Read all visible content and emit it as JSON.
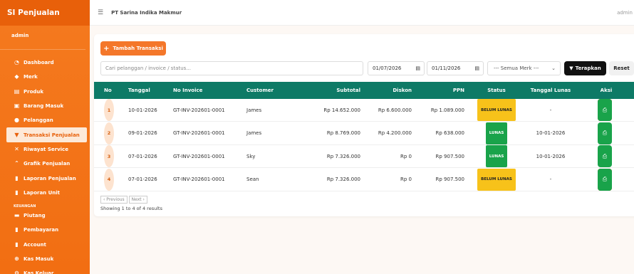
{
  "app": {
    "brand": "SI Penjualan",
    "user": "admin",
    "company": "PT Sarina Indika Makmur",
    "top_user": "admin"
  },
  "sidebar": {
    "items": [
      {
        "label": "Dashboard",
        "icon": "dashboard-icon"
      },
      {
        "label": "Merk",
        "icon": "tag-icon"
      },
      {
        "label": "Produk",
        "icon": "box-icon"
      },
      {
        "label": "Barang Masuk",
        "icon": "truck-icon"
      },
      {
        "label": "Pelanggan",
        "icon": "users-icon"
      },
      {
        "label": "Transaksi Penjualan",
        "icon": "cart-icon",
        "active": true
      },
      {
        "label": "Riwayat Service",
        "icon": "tools-icon"
      },
      {
        "label": "Grafik Penjualan",
        "icon": "chart-icon"
      },
      {
        "label": "Laporan Penjualan",
        "icon": "file-icon"
      },
      {
        "label": "Laporan Unit",
        "icon": "file-icon"
      }
    ],
    "section_keuangan": "KEUANGAN",
    "items2": [
      {
        "label": "Piutang",
        "icon": "card-icon"
      },
      {
        "label": "Pembayaran",
        "icon": "file-icon"
      },
      {
        "label": "Account",
        "icon": "book-icon"
      },
      {
        "label": "Kas Masuk",
        "icon": "plus-circle-icon"
      },
      {
        "label": "Kas Keluar",
        "icon": "minus-circle-icon"
      }
    ]
  },
  "toolbar": {
    "add_label": "Tambah Transaksi",
    "search_placeholder": "Cari pelanggan / invoice / status...",
    "date_from": "01/07/2026",
    "date_to": "01/11/2026",
    "merk_select": "--- Semua Merk ---",
    "apply_label": "Terapkan",
    "reset_label": "Reset"
  },
  "table": {
    "headers": [
      "No",
      "Tanggal",
      "No Invoice",
      "Customer",
      "Subtotal",
      "Diskon",
      "PPN",
      "Status",
      "Tanggal Lunas",
      "Aksi"
    ],
    "rows": [
      {
        "no": "1",
        "tanggal": "10-01-2026",
        "invoice": "GT-INV-202601-0001",
        "customer": "James",
        "subtotal": "Rp 14.652.000",
        "diskon": "Rp 6.600.000",
        "ppn": "Rp 1.089.000",
        "status": "BELUM LUNAS",
        "tgl_lunas": "-",
        "paid": false
      },
      {
        "no": "2",
        "tanggal": "09-01-2026",
        "invoice": "GT-INV-202601-0001",
        "customer": "James",
        "subtotal": "Rp 8.769.000",
        "diskon": "Rp 4.200.000",
        "ppn": "Rp 638.000",
        "status": "LUNAS",
        "tgl_lunas": "10-01-2026",
        "paid": true
      },
      {
        "no": "3",
        "tanggal": "07-01-2026",
        "invoice": "GT-INV-202601-0001",
        "customer": "Sky",
        "subtotal": "Rp 7.326.000",
        "diskon": "Rp 0",
        "ppn": "Rp 907.500",
        "status": "LUNAS",
        "tgl_lunas": "10-01-2026",
        "paid": true
      },
      {
        "no": "4",
        "tanggal": "07-01-2026",
        "invoice": "GT-INV-202601-0001",
        "customer": "Sean",
        "subtotal": "Rp 7.326.000",
        "diskon": "Rp 0",
        "ppn": "Rp 907.500",
        "status": "BELUM LUNAS",
        "tgl_lunas": "-",
        "paid": false
      }
    ]
  },
  "pagination": {
    "prev": "‹ Previous",
    "next": "Next ›",
    "info": "Showing 1 to 4 of 4 results"
  },
  "colors": {
    "brand": "#f47a1f",
    "header": "#0e7a66",
    "lunas": "#19a34a",
    "belum": "#f7c21a",
    "danger": "#dc3545"
  }
}
